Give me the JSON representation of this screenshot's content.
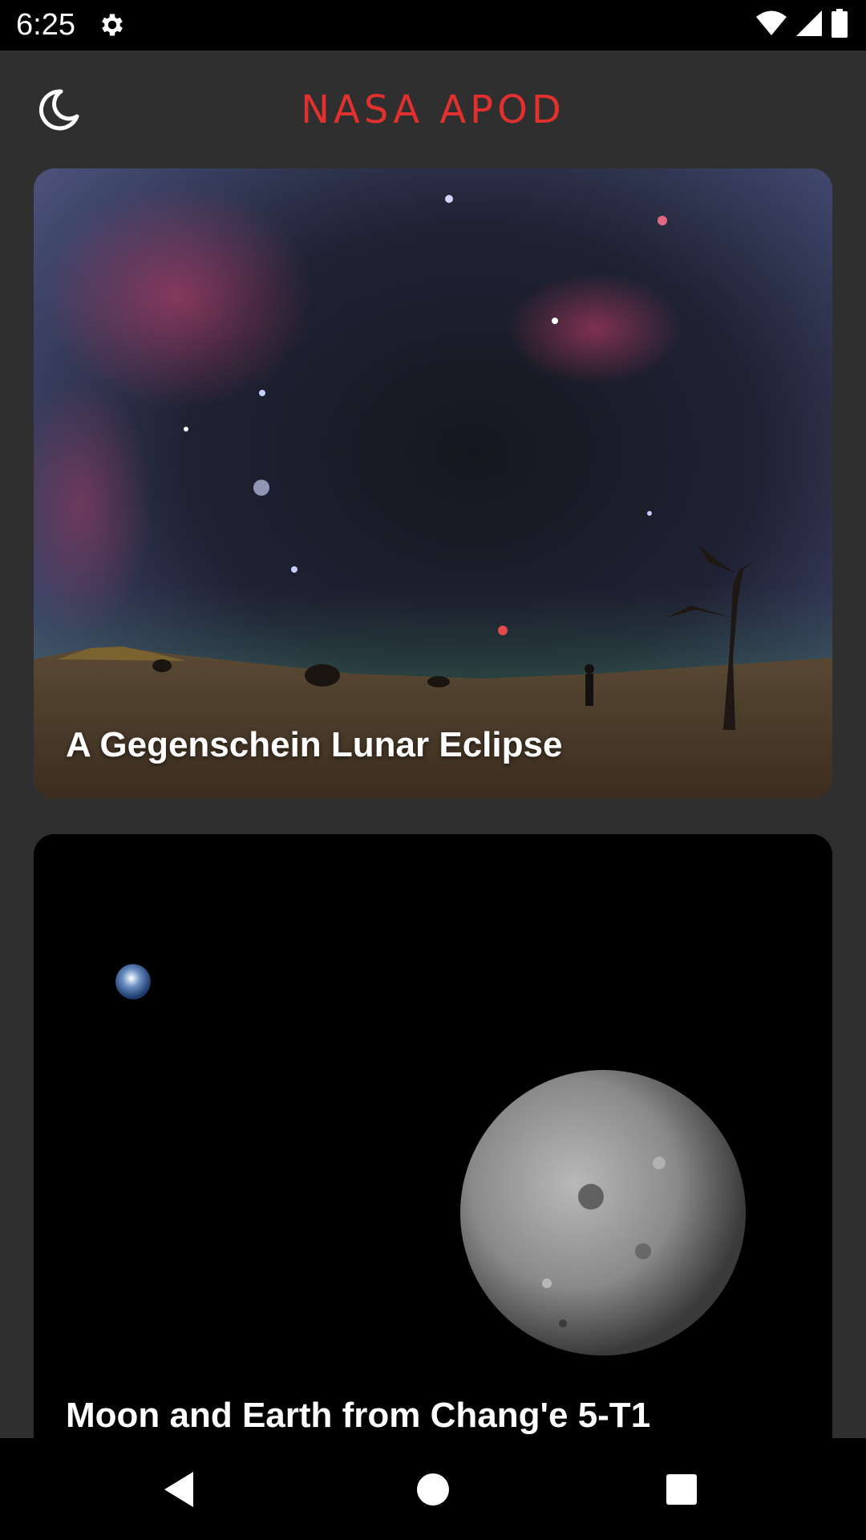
{
  "status_bar": {
    "time": "6:25",
    "icons": [
      "settings-icon",
      "wifi-icon",
      "cellular-signal-icon",
      "battery-icon"
    ]
  },
  "header": {
    "title": "NASA APOD",
    "theme_icon": "moon-icon",
    "title_color": "#e0312f"
  },
  "feed": {
    "items": [
      {
        "title": "A Gegenschein Lunar Eclipse"
      },
      {
        "title": "Moon and Earth from Chang'e 5-T1"
      }
    ]
  },
  "nav_bar": {
    "buttons": [
      "back-icon",
      "home-icon",
      "recents-icon"
    ]
  },
  "colors": {
    "background": "#2f2f2f",
    "bars": "#000000",
    "accent": "#e0312f"
  }
}
